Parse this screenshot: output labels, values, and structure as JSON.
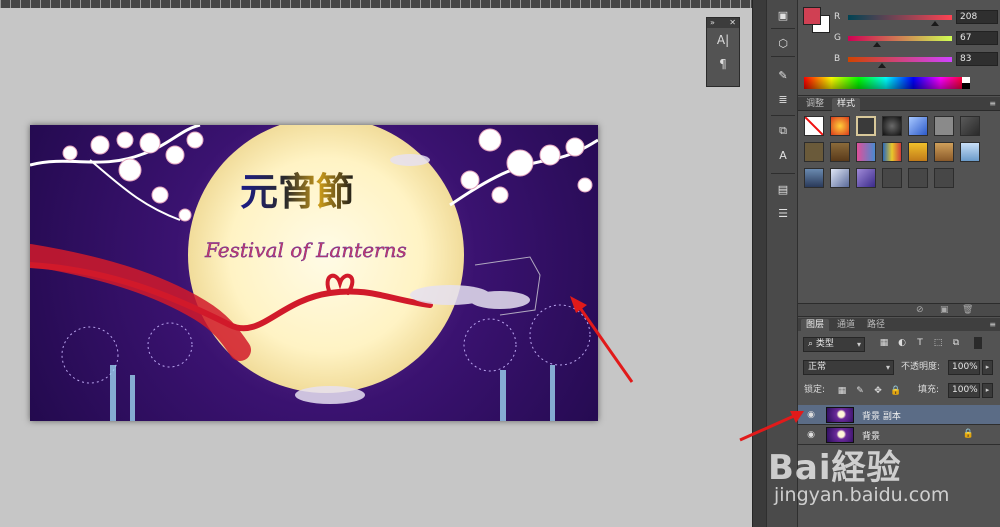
{
  "document": {
    "chinese_title": "元宵節",
    "subtitle": "Festival of Lanterns"
  },
  "mini_panel": {
    "collapse_label": "»",
    "close_label": "✕",
    "char_icon": "character-panel-icon",
    "para_icon": "paragraph-panel-icon"
  },
  "color_panel": {
    "foreground_color": "#d04053",
    "background_color": "#ffffff",
    "channels": [
      {
        "label": "R",
        "value": "208"
      },
      {
        "label": "G",
        "value": "67"
      },
      {
        "label": "B",
        "value": "83"
      }
    ]
  },
  "styles_panel": {
    "tabs": [
      {
        "label": "调整",
        "active": false
      },
      {
        "label": "样式",
        "active": true
      }
    ],
    "swatch_colors": [
      "none",
      "#d9391c",
      "#c9b48a",
      "#2a2a2a",
      "#4c77c9",
      "#8a8a8a",
      "#3a3a3a",
      "#9a7a3a",
      "#6a5a4a",
      "#b24a7a",
      "#2e6f9a",
      "#d49a2a",
      "#9a6a3a",
      "#89a9c9",
      "#3a5a8a",
      "#7a8ab0",
      "#6a4ab0",
      "#4a4a4a",
      "#4a4a4a",
      "#4a4a4a"
    ]
  },
  "layers_panel": {
    "tabs": [
      {
        "label": "图层",
        "active": true
      },
      {
        "label": "通道",
        "active": false
      },
      {
        "label": "路径",
        "active": false
      }
    ],
    "filter_kind": "类型",
    "blend_mode": "正常",
    "opacity_label": "不透明度:",
    "opacity_value": "100%",
    "lock_label": "锁定:",
    "fill_label": "填充:",
    "fill_value": "100%",
    "layers": [
      {
        "name": "背景 副本",
        "selected": true,
        "locked": false
      },
      {
        "name": "背景",
        "selected": false,
        "locked": true
      }
    ]
  },
  "watermark": {
    "logo_text": "Bai経验",
    "url_text": "jingyan.baidu.com"
  }
}
